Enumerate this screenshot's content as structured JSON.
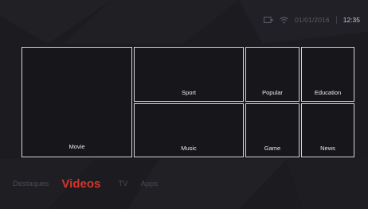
{
  "status": {
    "date": "01/01/2016",
    "time": "12:35",
    "icons": [
      "input-source-icon",
      "wifi-icon"
    ]
  },
  "tiles": {
    "movie": "Movie",
    "sport": "Sport",
    "popular": "Popular",
    "education": "Education",
    "music": "Music",
    "game": "Game",
    "news": "News"
  },
  "nav": {
    "items": [
      "Destaques",
      "Videos",
      "TV",
      "Apps"
    ],
    "active": "Videos"
  },
  "colors": {
    "background": "#1c1c20",
    "accent": "#d4362d",
    "tile_border": "#d4d4d8",
    "inactive_text": "#4a4b53"
  }
}
